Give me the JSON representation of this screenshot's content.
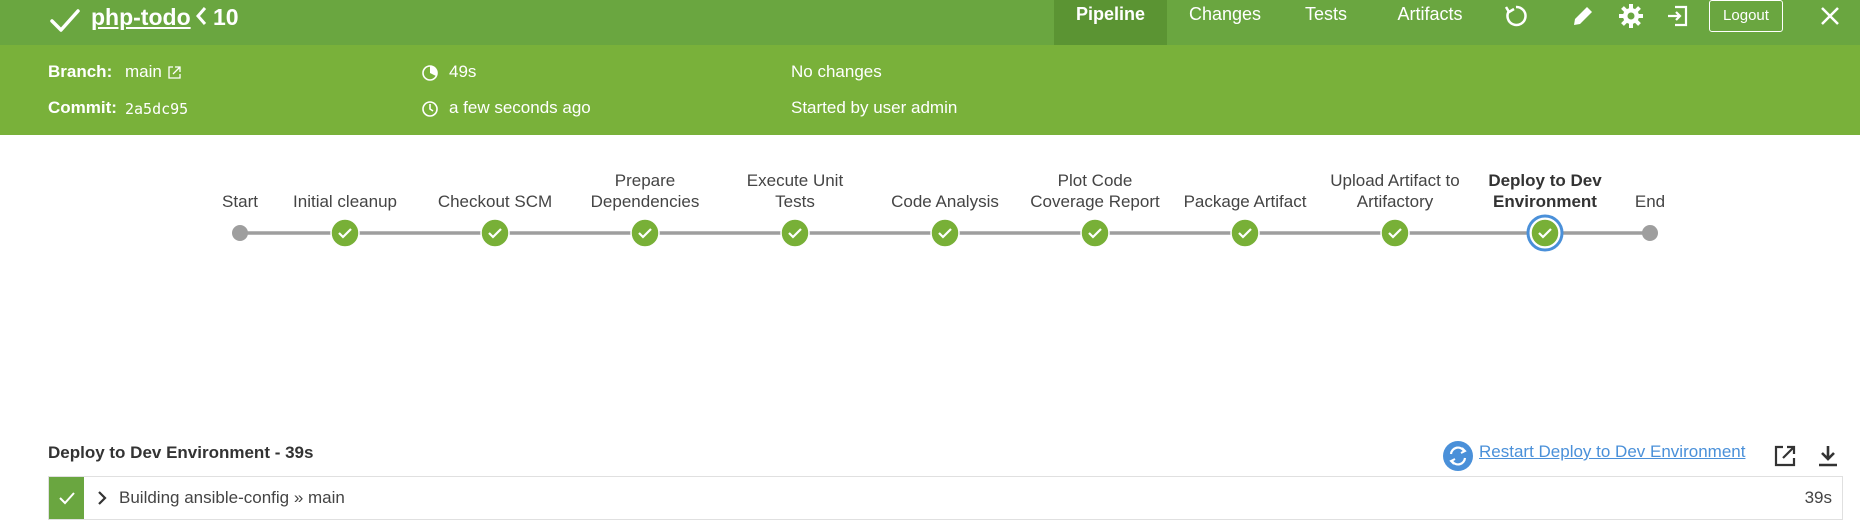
{
  "header": {
    "title": "php-todo",
    "run_number": "10",
    "tabs": [
      {
        "label": "Pipeline",
        "active": true
      },
      {
        "label": "Changes",
        "active": false
      },
      {
        "label": "Tests",
        "active": false
      },
      {
        "label": "Artifacts",
        "active": false
      }
    ],
    "icons": [
      "replay-icon",
      "edit-icon",
      "settings-icon",
      "exit-classic-icon",
      "close-icon"
    ],
    "logout_label": "Logout",
    "status_color": "#6aa640"
  },
  "summary": {
    "branch_label": "Branch:",
    "branch_value": "main",
    "commit_label": "Commit:",
    "commit_value": "2a5dc95",
    "duration": "49s",
    "started": "a few seconds ago",
    "changes": "No changes",
    "started_by": "Started by user admin"
  },
  "pipeline": {
    "stages": [
      {
        "label": "Start",
        "kind": "terminal"
      },
      {
        "label": "Initial cleanup",
        "kind": "success"
      },
      {
        "label": "Checkout SCM",
        "kind": "success"
      },
      {
        "label": "Prepare Dependencies",
        "kind": "success"
      },
      {
        "label": "Execute Unit Tests",
        "kind": "success"
      },
      {
        "label": "Code Analysis",
        "kind": "success"
      },
      {
        "label": "Plot Code Coverage Report",
        "kind": "success"
      },
      {
        "label": "Package Artifact",
        "kind": "success"
      },
      {
        "label": "Upload Artifact to Artifactory",
        "kind": "success"
      },
      {
        "label": "Deploy to Dev Environment",
        "kind": "success",
        "selected": true
      },
      {
        "label": "End",
        "kind": "terminal"
      }
    ],
    "success_color": "#78b037",
    "selected_ring_color": "#4a90d9"
  },
  "step_panel": {
    "title": "Deploy to Dev Environment - 39s",
    "restart_label": "Restart Deploy to Dev Environment",
    "steps": [
      {
        "text": "Building ansible-config » main",
        "duration": "39s",
        "status": "success"
      }
    ]
  }
}
